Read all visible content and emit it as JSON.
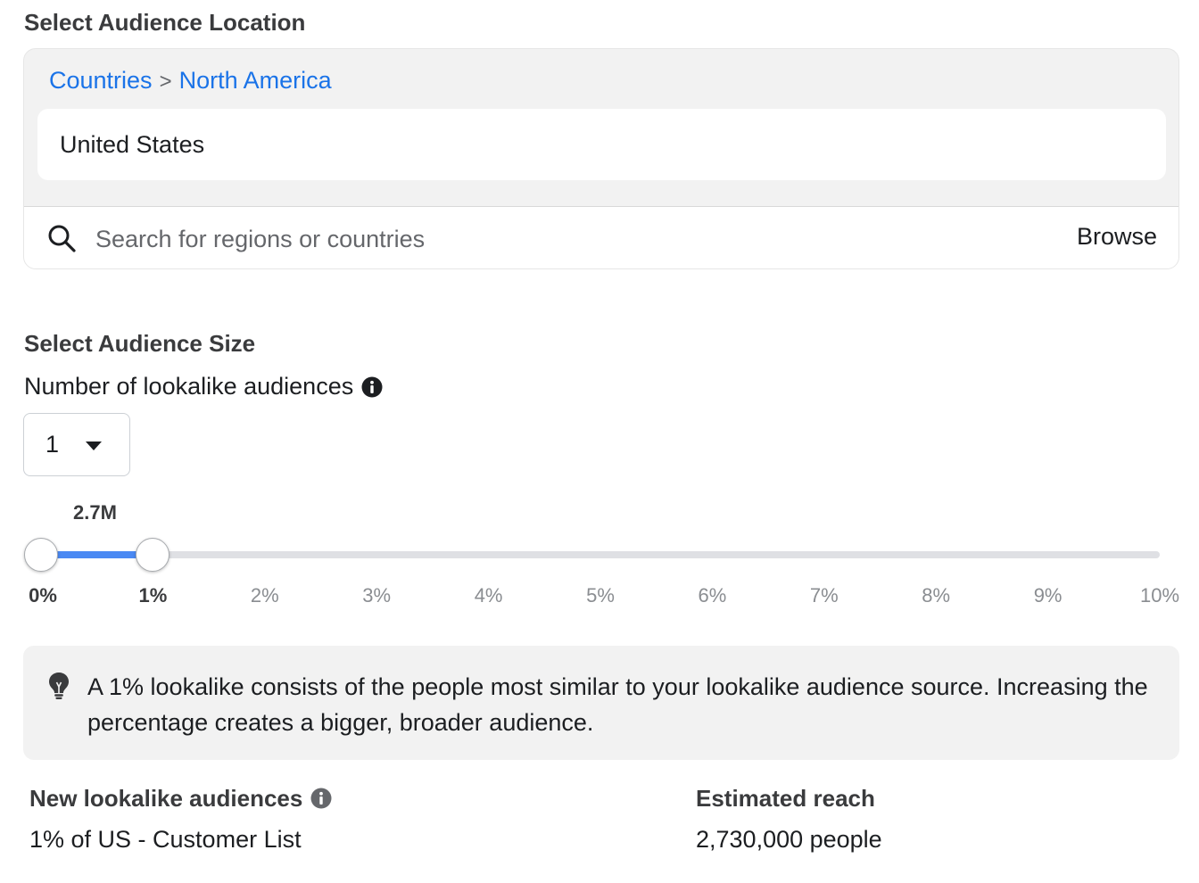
{
  "location": {
    "title": "Select Audience Location",
    "breadcrumb": [
      "Countries",
      "North America"
    ],
    "breadcrumb_separator": ">",
    "selected": "United States",
    "search_placeholder": "Search for regions or countries",
    "browse_label": "Browse"
  },
  "size": {
    "title": "Select Audience Size",
    "count_label": "Number of lookalike audiences",
    "count_value": "1",
    "slider": {
      "reach_label": "2.7M",
      "start_percent": 0,
      "end_percent": 1,
      "ticks": [
        "0%",
        "1%",
        "2%",
        "3%",
        "4%",
        "5%",
        "6%",
        "7%",
        "8%",
        "9%",
        "10%"
      ],
      "active_ticks": [
        "0%",
        "1%"
      ],
      "fill_color": "#4a89f3"
    }
  },
  "tip": {
    "text": "A 1% lookalike consists of the people most similar to your lookalike audience source. Increasing the percentage creates a bigger, broader audience."
  },
  "results": {
    "new_heading": "New lookalike audiences",
    "new_value": "1% of US - Customer List",
    "reach_heading": "Estimated reach",
    "reach_value": "2,730,000 people"
  },
  "icons": {
    "search": "search-icon",
    "info": "info-icon",
    "bulb": "lightbulb-icon",
    "caret": "caret-down-icon"
  },
  "colors": {
    "link": "#1a73e8",
    "slider_fill": "#4a89f3",
    "track": "#dfe0e4"
  }
}
